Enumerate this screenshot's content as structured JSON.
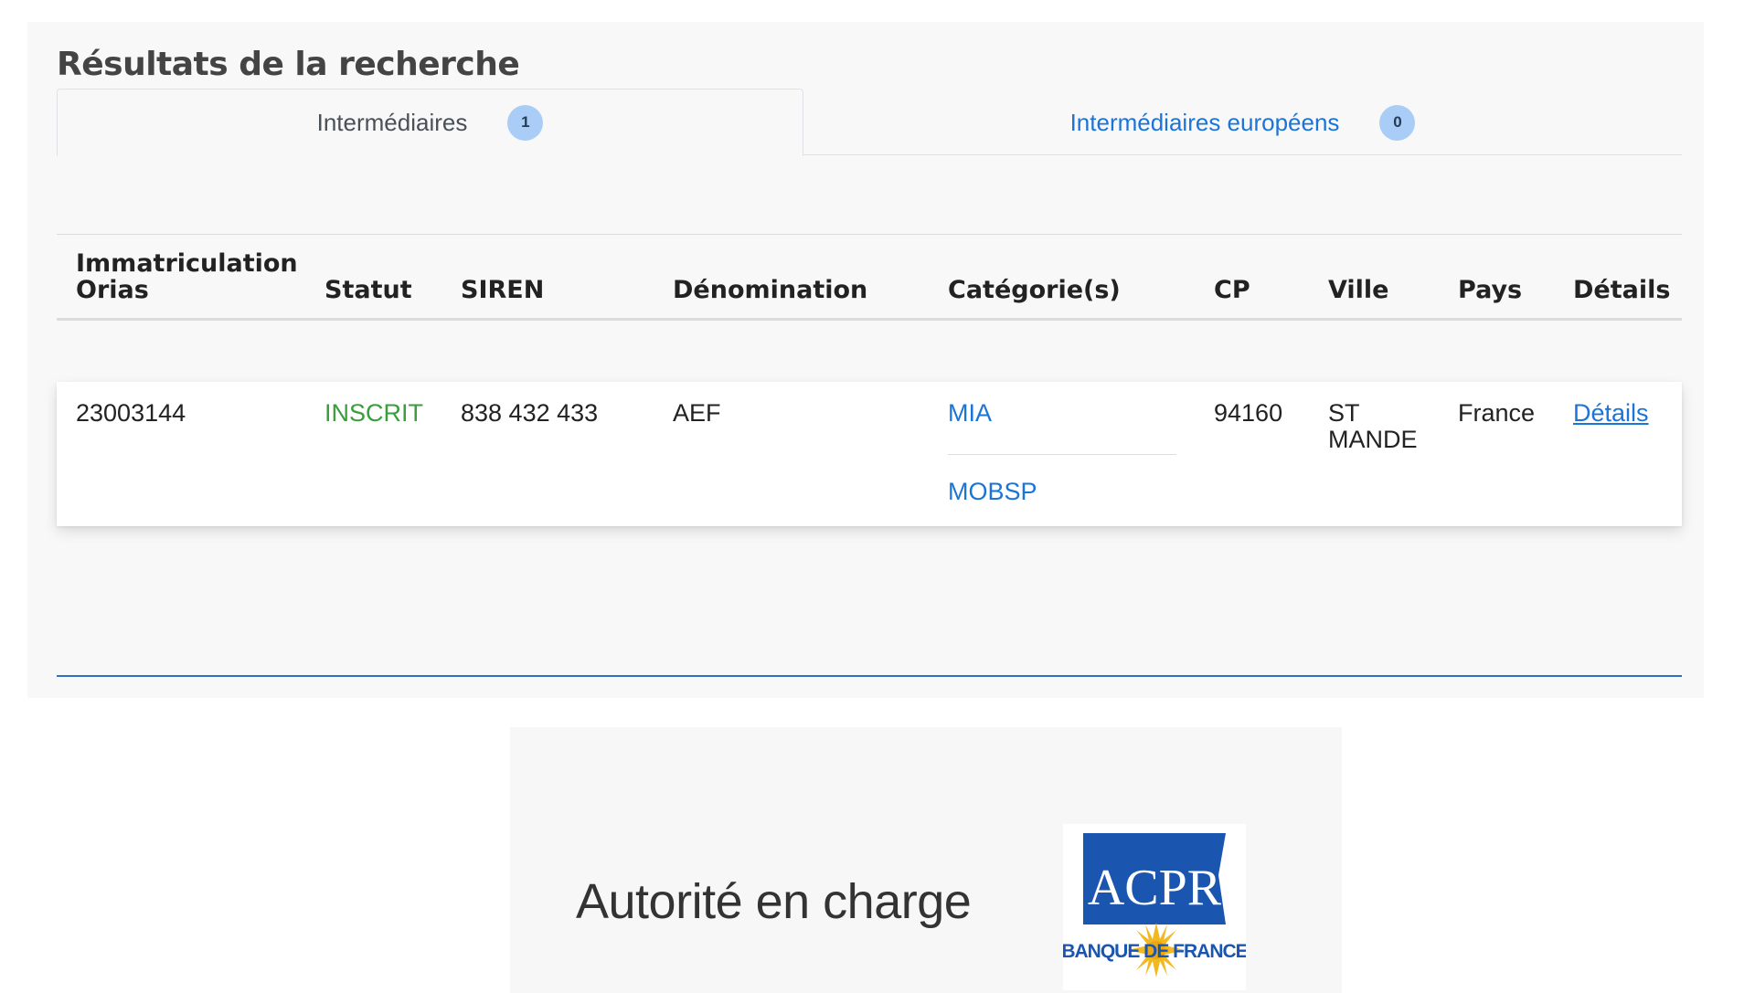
{
  "page": {
    "title": "Résultats de la recherche"
  },
  "tabs": [
    {
      "label": "Intermédiaires",
      "count": "1",
      "active": true
    },
    {
      "label": "Intermédiaires européens",
      "count": "0",
      "active": false
    }
  ],
  "table": {
    "headers": {
      "immatriculation_line1": "Immatriculation",
      "immatriculation_line2": "Orias",
      "statut": "Statut",
      "siren": "SIREN",
      "denomination": "Dénomination",
      "categories": "Catégorie(s)",
      "cp": "CP",
      "ville": "Ville",
      "pays": "Pays",
      "details": "Détails"
    },
    "rows": [
      {
        "immatriculation": "23003144",
        "statut": "INSCRIT",
        "siren": "838 432 433",
        "denomination": "AEF",
        "categories": [
          "MIA",
          "MOBSP"
        ],
        "cp": "94160",
        "ville_line1": "ST",
        "ville_line2": "MANDE",
        "pays": "France",
        "details_link": "Détails"
      }
    ]
  },
  "footer": {
    "authority_label": "Autorité en charge",
    "logo": {
      "name": "ACPR",
      "text_main": "ACPR",
      "text_sub": "BANQUE DE FRANCE"
    }
  },
  "colors": {
    "link": "#1b74d8",
    "status_registered": "#3a9e3a",
    "badge_bg": "#a9cdf6",
    "logo_blue": "#1a56b0",
    "logo_sun": "#f2b822"
  }
}
